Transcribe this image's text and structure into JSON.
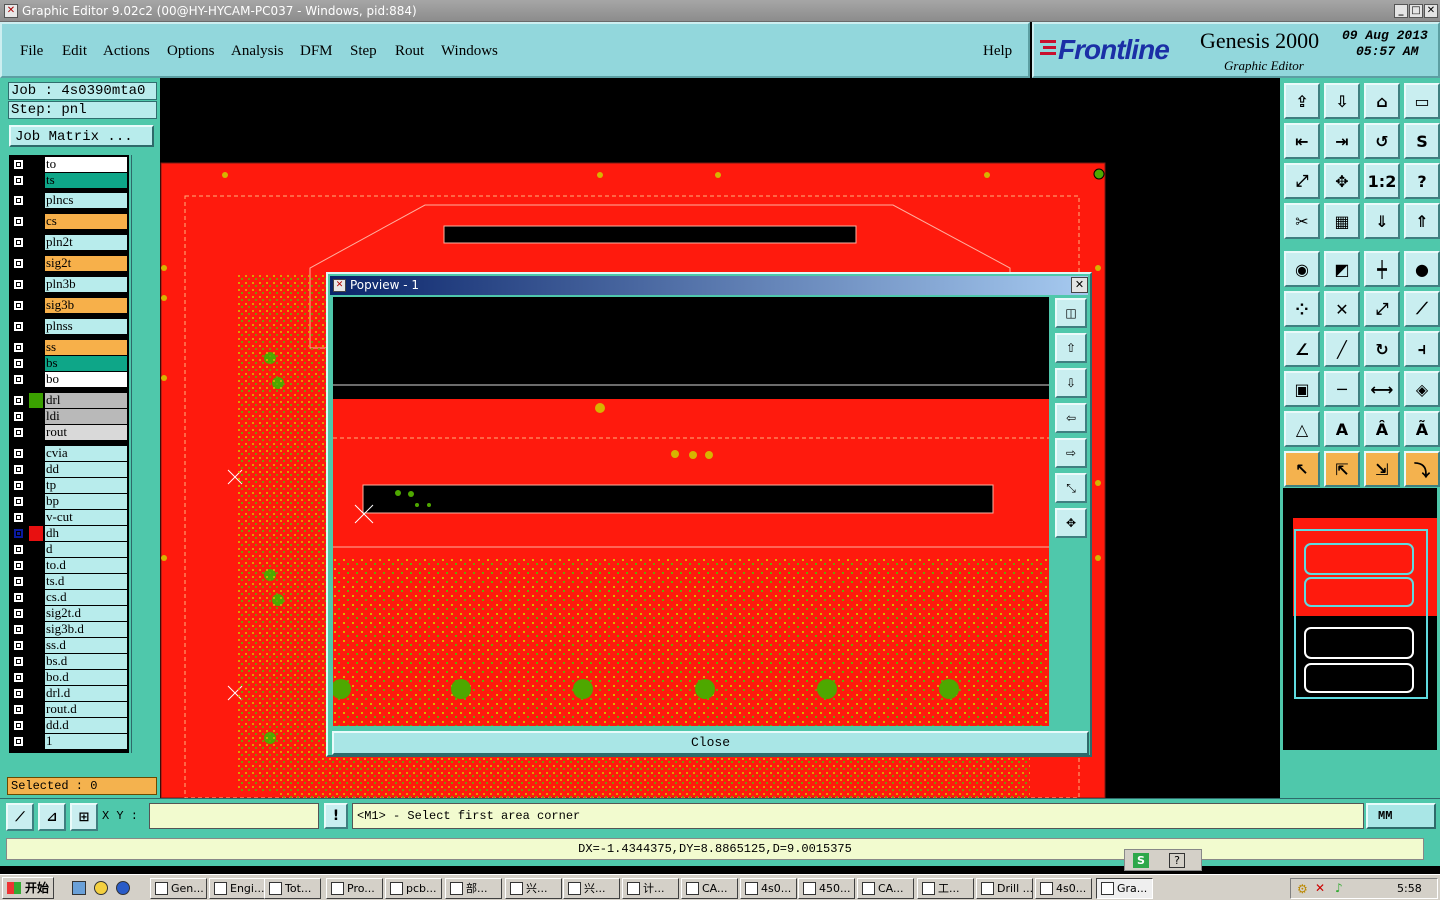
{
  "window": {
    "title": "Graphic Editor 9.02c2 (00@HY-HYCAM-PC037 - Windows, pid:884)"
  },
  "menubar": {
    "items": [
      "File",
      "Edit",
      "Actions",
      "Options",
      "Analysis",
      "DFM",
      "Step",
      "Rout",
      "Windows"
    ],
    "help": "Help"
  },
  "brand": {
    "logo": "Frontline",
    "product": "Genesis 2000",
    "subtitle": "Graphic Editor",
    "date": "09 Aug 2013",
    "time": "05:57 AM"
  },
  "job": {
    "job_label": "Job : 4s0390mta0",
    "step_label": "Step: pnl",
    "matrix_button": "Job Matrix ...",
    "selected_label": "Selected : 0"
  },
  "layers": [
    {
      "name": "to",
      "color": "#ffffff"
    },
    {
      "name": "ts",
      "color": "#0ea688"
    },
    {
      "name": "plncs",
      "color": "#b8ecec"
    },
    {
      "name": "cs",
      "color": "#f7b04a"
    },
    {
      "name": "pln2t",
      "color": "#b8ecec"
    },
    {
      "name": "sig2t",
      "color": "#f7b04a"
    },
    {
      "name": "pln3b",
      "color": "#b8ecec"
    },
    {
      "name": "sig3b",
      "color": "#f7b04a"
    },
    {
      "name": "plnss",
      "color": "#b8ecec"
    },
    {
      "name": "ss",
      "color": "#f7b04a"
    },
    {
      "name": "bs",
      "color": "#0ea688"
    },
    {
      "name": "bo",
      "color": "#ffffff"
    },
    {
      "name": "drl",
      "color": "#b9b9b9"
    },
    {
      "name": "ldi",
      "color": "#b9b9b9"
    },
    {
      "name": "rout",
      "color": "#d9d9d9"
    },
    {
      "name": "cvia",
      "color": "#b8ecec"
    },
    {
      "name": "dd",
      "color": "#b8ecec"
    },
    {
      "name": "tp",
      "color": "#b8ecec"
    },
    {
      "name": "bp",
      "color": "#b8ecec"
    },
    {
      "name": "v-cut",
      "color": "#b8ecec"
    },
    {
      "name": "dh",
      "color": "#b8ecec"
    },
    {
      "name": "d",
      "color": "#b8ecec"
    },
    {
      "name": "to.d",
      "color": "#b8ecec"
    },
    {
      "name": "ts.d",
      "color": "#b8ecec"
    },
    {
      "name": "cs.d",
      "color": "#b8ecec"
    },
    {
      "name": "sig2t.d",
      "color": "#b8ecec"
    },
    {
      "name": "sig3b.d",
      "color": "#b8ecec"
    },
    {
      "name": "ss.d",
      "color": "#b8ecec"
    },
    {
      "name": "bs.d",
      "color": "#b8ecec"
    },
    {
      "name": "bo.d",
      "color": "#b8ecec"
    },
    {
      "name": "drl.d",
      "color": "#b8ecec"
    },
    {
      "name": "rout.d",
      "color": "#b8ecec"
    },
    {
      "name": "dd.d",
      "color": "#b8ecec"
    },
    {
      "name": "1",
      "color": "#b8ecec"
    }
  ],
  "popview": {
    "title": "Popview - 1",
    "close_label": "Close"
  },
  "command": {
    "xy_label": "X Y :",
    "xy_value": "",
    "prompt": "<M1> - Select first area corner",
    "units": "MM"
  },
  "status": {
    "text": "DX=-1.4344375,DY=8.8865125,D=9.0015375"
  },
  "taskbar": {
    "start": "开始",
    "clock": "5:58",
    "tasks": [
      "Gen...",
      "Engi...",
      "Tot...",
      "Pro...",
      "pcb...",
      "部...",
      "兴...",
      "兴...",
      "计...",
      "CA...",
      "4s0...",
      "450...",
      "CA...",
      "工...",
      "Drill ...",
      "4s0...",
      "Gra..."
    ]
  },
  "colors": {
    "board": "#ff1a0d",
    "panel": "#4fc8ab",
    "menu": "#92d7dc",
    "pad": "#4ea800",
    "silk": "#d7b400"
  }
}
